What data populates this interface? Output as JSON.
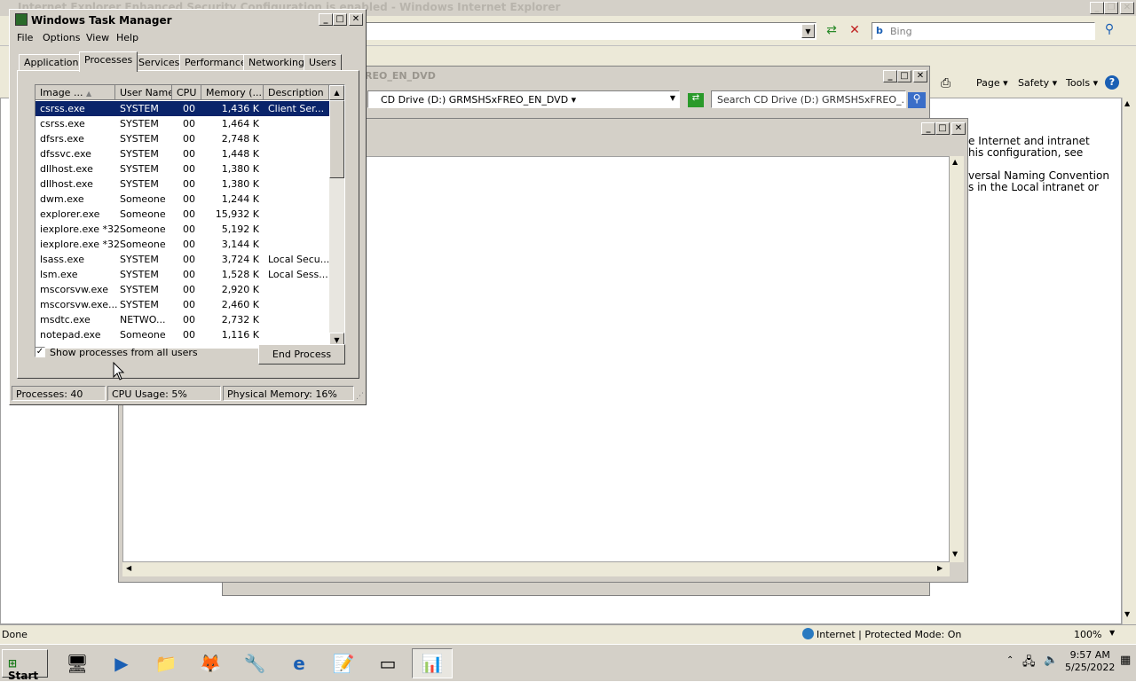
{
  "ie": {
    "title": "Internet Explorer Enhanced Security Configuration is enabled - Windows Internet Explorer",
    "search_placeholder": "Bing",
    "cmd_page": "Page",
    "cmd_safety": "Safety",
    "cmd_tools": "Tools",
    "content_lines": [
      "e Internet and intranet",
      "his configuration, see",
      "",
      "versal Naming Convention",
      "s in the Local intranet or"
    ],
    "status_left": "Done",
    "status_zone": "Internet | Protected Mode: On",
    "zoom": "100%"
  },
  "explorer": {
    "title_fragment": "REO_EN_DVD",
    "address": "CD Drive (D:) GRMSHSxFREO_EN_DVD",
    "search_placeholder": "Search CD Drive (D:) GRMSHSxFREO_..."
  },
  "taskbar": {
    "start_label": "Start",
    "time": "9:57 AM",
    "date": "5/25/2022"
  },
  "tm": {
    "title": "Windows Task Manager",
    "menu": [
      "File",
      "Options",
      "View",
      "Help"
    ],
    "tabs": [
      "Applications",
      "Processes",
      "Services",
      "Performance",
      "Networking",
      "Users"
    ],
    "columns": [
      "Image ...",
      "User Name",
      "CPU",
      "Memory (...",
      "Description"
    ],
    "rows": [
      {
        "image": "csrss.exe",
        "user": "SYSTEM",
        "cpu": "00",
        "mem": "1,436 K",
        "desc": "Client Ser..."
      },
      {
        "image": "csrss.exe",
        "user": "SYSTEM",
        "cpu": "00",
        "mem": "1,464 K",
        "desc": ""
      },
      {
        "image": "dfsrs.exe",
        "user": "SYSTEM",
        "cpu": "00",
        "mem": "2,748 K",
        "desc": ""
      },
      {
        "image": "dfssvc.exe",
        "user": "SYSTEM",
        "cpu": "00",
        "mem": "1,448 K",
        "desc": ""
      },
      {
        "image": "dllhost.exe",
        "user": "SYSTEM",
        "cpu": "00",
        "mem": "1,380 K",
        "desc": ""
      },
      {
        "image": "dllhost.exe",
        "user": "SYSTEM",
        "cpu": "00",
        "mem": "1,380 K",
        "desc": ""
      },
      {
        "image": "dwm.exe",
        "user": "Someone",
        "cpu": "00",
        "mem": "1,244 K",
        "desc": ""
      },
      {
        "image": "explorer.exe",
        "user": "Someone",
        "cpu": "00",
        "mem": "15,932 K",
        "desc": ""
      },
      {
        "image": "iexplore.exe *32",
        "user": "Someone",
        "cpu": "00",
        "mem": "5,192 K",
        "desc": ""
      },
      {
        "image": "iexplore.exe *32",
        "user": "Someone",
        "cpu": "00",
        "mem": "3,144 K",
        "desc": ""
      },
      {
        "image": "lsass.exe",
        "user": "SYSTEM",
        "cpu": "00",
        "mem": "3,724 K",
        "desc": "Local Secu..."
      },
      {
        "image": "lsm.exe",
        "user": "SYSTEM",
        "cpu": "00",
        "mem": "1,528 K",
        "desc": "Local Sess..."
      },
      {
        "image": "mscorsvw.exe",
        "user": "SYSTEM",
        "cpu": "00",
        "mem": "2,920 K",
        "desc": ""
      },
      {
        "image": "mscorsvw.exe...",
        "user": "SYSTEM",
        "cpu": "00",
        "mem": "2,460 K",
        "desc": ""
      },
      {
        "image": "msdtc.exe",
        "user": "NETWO...",
        "cpu": "00",
        "mem": "2,732 K",
        "desc": ""
      },
      {
        "image": "notepad.exe",
        "user": "Someone",
        "cpu": "00",
        "mem": "1,116 K",
        "desc": ""
      }
    ],
    "show_all_label": "Show processes from all users",
    "end_process_label": "End Process",
    "status_processes": "Processes: 40",
    "status_cpu": "CPU Usage: 5%",
    "status_memory": "Physical Memory: 16%"
  }
}
